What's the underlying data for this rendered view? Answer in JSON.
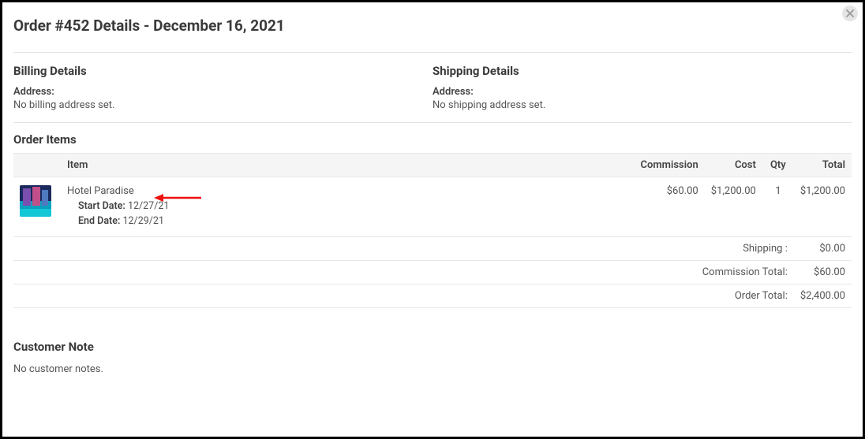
{
  "modal": {
    "title": "Order #452 Details - December 16, 2021",
    "close_label": "Close"
  },
  "billing": {
    "heading": "Billing Details",
    "address_label": "Address:",
    "address_text": "No billing address set."
  },
  "shipping": {
    "heading": "Shipping Details",
    "address_label": "Address:",
    "address_text": "No shipping address set."
  },
  "order_items": {
    "heading": "Order Items",
    "columns": {
      "item": "Item",
      "commission": "Commission",
      "cost": "Cost",
      "qty": "Qty",
      "total": "Total"
    },
    "rows": [
      {
        "name": "Hotel Paradise",
        "start_date_label": "Start Date:",
        "start_date": "12/27/21",
        "end_date_label": "End Date:",
        "end_date": "12/29/21",
        "commission": "$60.00",
        "cost": "$1,200.00",
        "qty": "1",
        "total": "$1,200.00"
      }
    ],
    "totals": {
      "shipping_label": "Shipping :",
      "shipping_value": "$0.00",
      "commission_label": "Commission Total:",
      "commission_value": "$60.00",
      "order_label": "Order Total:",
      "order_value": "$2,400.00"
    }
  },
  "customer_note": {
    "heading": "Customer Note",
    "body": "No customer notes."
  }
}
